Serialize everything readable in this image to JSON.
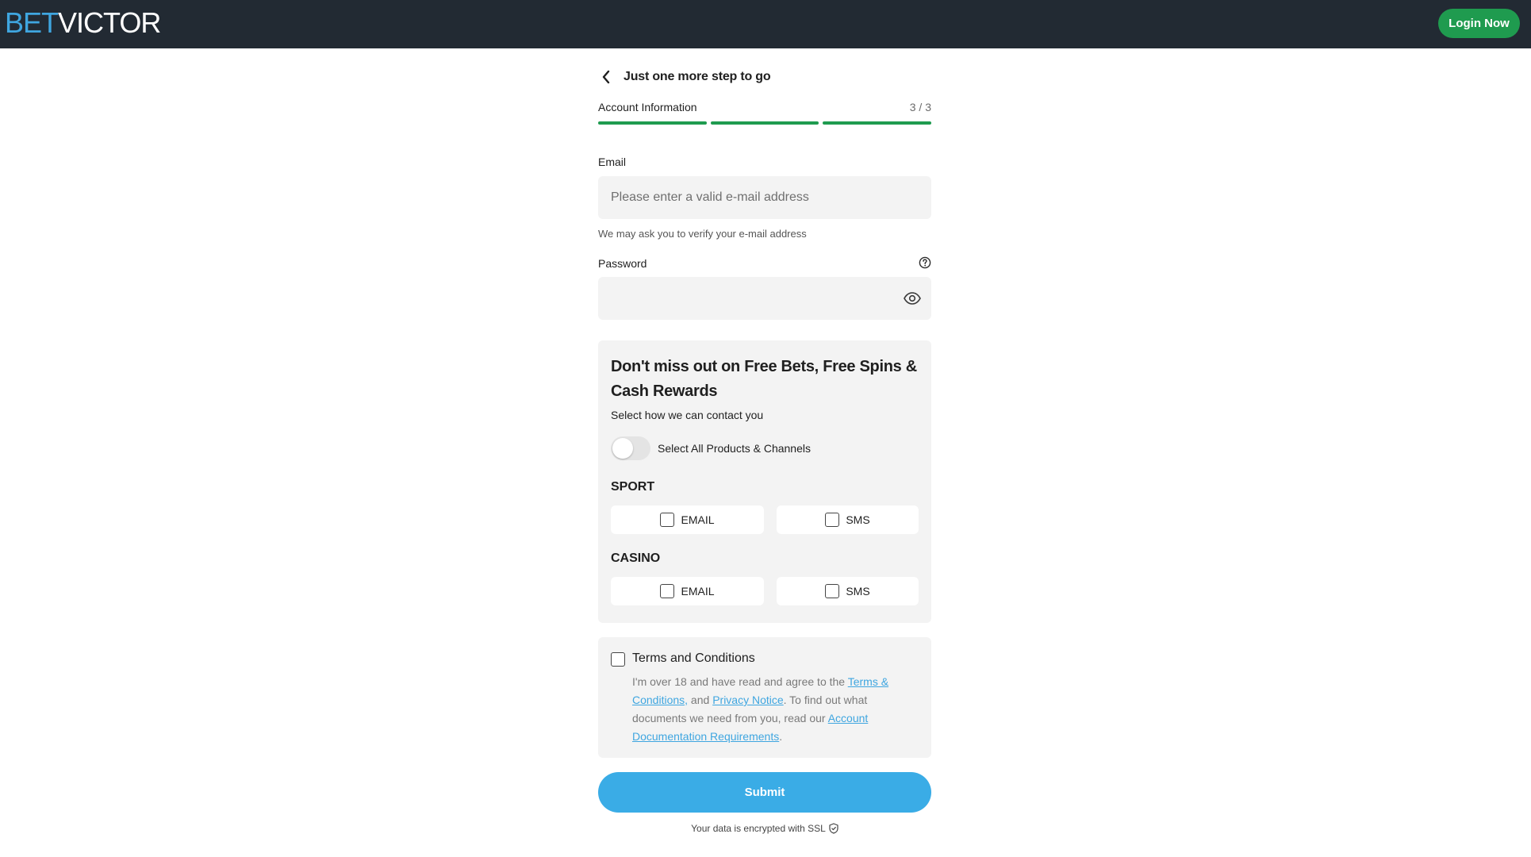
{
  "header": {
    "logo_bet": "BET",
    "logo_victor": "VICTOR",
    "login_label": "Login Now"
  },
  "step": {
    "title": "Just one more step to go",
    "section": "Account Information",
    "count": "3 / 3",
    "progress": {
      "completed": 3,
      "total": 3
    }
  },
  "email": {
    "label": "Email",
    "placeholder": "Please enter a valid e-mail address",
    "hint": "We may ask you to verify your e-mail address"
  },
  "password": {
    "label": "Password",
    "value": ""
  },
  "marketing": {
    "title": "Don't miss out on Free Bets, Free Spins & Cash Rewards",
    "subtitle": "Select how we can contact you",
    "toggle_label": "Select All Products & Channels",
    "toggle_on": false,
    "sections": [
      {
        "name": "SPORT",
        "options": [
          {
            "label": "EMAIL",
            "checked": false
          },
          {
            "label": "SMS",
            "checked": false
          }
        ]
      },
      {
        "name": "CASINO",
        "options": [
          {
            "label": "EMAIL",
            "checked": false
          },
          {
            "label": "SMS",
            "checked": false
          }
        ]
      }
    ]
  },
  "terms": {
    "title": "Terms and Conditions",
    "text_1": "I'm over 18 and have read and agree to the ",
    "link_terms": "Terms & Conditions,",
    "text_2": " and ",
    "link_privacy": "Privacy Notice",
    "text_3": ". To find out what documents we need from you, read our ",
    "link_docs": "Account Documentation Requirements",
    "text_4": ".",
    "checked": false
  },
  "submit_label": "Submit",
  "ssl_note": "Your data is encrypted with SSL",
  "colors": {
    "header_bg": "#222a33",
    "brand_blue": "#3fa6e0",
    "brand_green": "#1f9b4f",
    "submit_blue": "#3aace6",
    "field_bg": "#f3f3f3"
  },
  "icons": {
    "back": "chevron-left-icon",
    "help": "question-circle-icon",
    "eye": "eye-icon",
    "ssl": "shield-check-icon"
  }
}
